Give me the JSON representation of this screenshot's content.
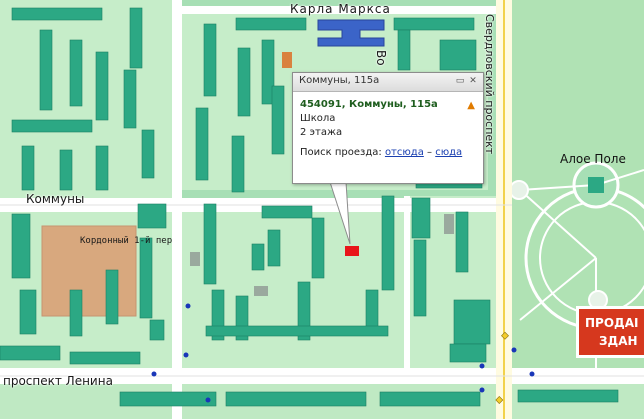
{
  "map": {
    "streets": {
      "karla_marksa": "Карла Маркса",
      "kommuny": "Коммуны",
      "sverdlovsky": "Свердловский проспект",
      "lenina": "проспект Ленина",
      "kordonny": "Кордонный 1-й пер",
      "vo": "Во"
    },
    "park": "Алое Поле",
    "marker": {
      "color": "#e8151a"
    },
    "colors": {
      "ground": "#a7dfb5",
      "block": "#c6edc9",
      "road": "#ffffff",
      "building": "#2ca884",
      "brown_area": "#d8a87e",
      "blue_building": "#3b64c8",
      "park": "#b4e4b8"
    }
  },
  "popup": {
    "title": "Коммуны, 115а",
    "address": "454091, Коммуны, 115а",
    "type": "Школа",
    "floors": "2 этажа",
    "route_label": "Поиск проезда:",
    "route_from": "отсюда",
    "route_sep": "–",
    "route_to": "сюда",
    "minimize_icon": "minimize-icon",
    "close_icon": "close-icon",
    "warning_icon": "warning-icon"
  },
  "ad": {
    "line1": "ПРОДАІ",
    "line2": "ЗДАН"
  }
}
